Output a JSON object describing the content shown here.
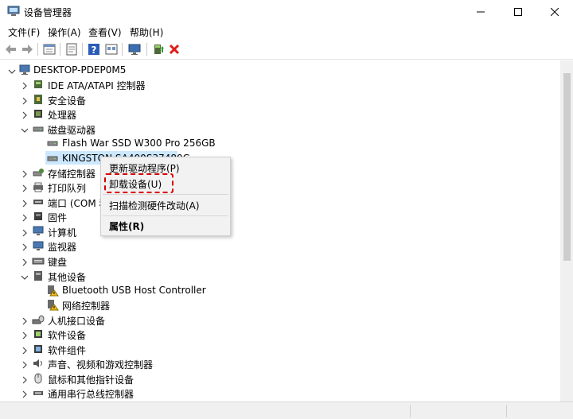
{
  "window": {
    "title": "设备管理器",
    "minimize_glyph": "—",
    "maximize_glyph": "☐",
    "close_glyph": "✕"
  },
  "menu": [
    "文件(F)",
    "操作(A)",
    "查看(V)",
    "帮助(H)"
  ],
  "toolbar_icons": [
    "back-arrow-icon",
    "forward-arrow-icon",
    "properties-icon",
    "show-hidden-icon",
    "help-icon",
    "view-icon",
    "monitor-icon",
    "update-driver-icon",
    "remove-device-icon"
  ],
  "tree": {
    "root": "DESKTOP-PDEP0M5",
    "items": [
      "IDE ATA/ATAPI 控制器",
      "安全设备",
      "处理器",
      "磁盘驱动器",
      "Flash War SSD W300 Pro 256GB",
      "KINGSTON SA400S37480G",
      "存储控制器",
      "打印队列",
      "端口 (COM 和 LPT)",
      "固件",
      "计算机",
      "监视器",
      "键盘",
      "其他设备",
      "Bluetooth USB Host Controller",
      "网络控制器",
      "人机接口设备",
      "软件设备",
      "软件组件",
      "声音、视频和游戏控制器",
      "鼠标和其他指针设备",
      "通用串行总线控制器"
    ]
  },
  "context_menu": {
    "update_driver": "更新驱动程序(P)",
    "uninstall": "卸载设备(U)",
    "scan": "扫描检测硬件改动(A)",
    "properties": "属性(R)"
  },
  "colors": {
    "selection": "#cce8ff",
    "highlight_dash": "#d80000",
    "menu_background": "#f2f2f2"
  }
}
